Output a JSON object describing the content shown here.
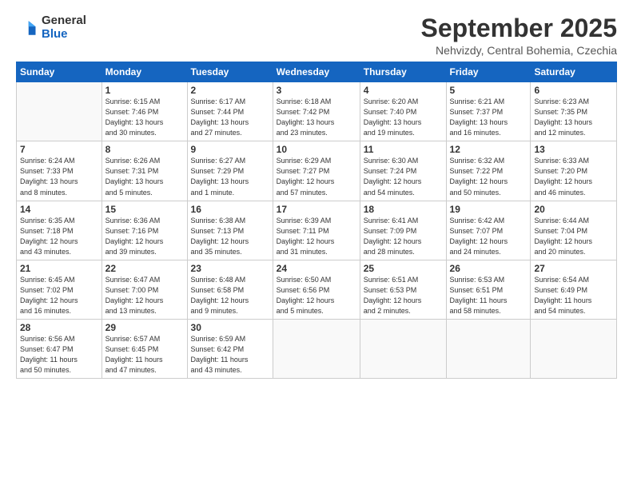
{
  "logo": {
    "general": "General",
    "blue": "Blue"
  },
  "title": "September 2025",
  "subtitle": "Nehvizdy, Central Bohemia, Czechia",
  "days_header": [
    "Sunday",
    "Monday",
    "Tuesday",
    "Wednesday",
    "Thursday",
    "Friday",
    "Saturday"
  ],
  "weeks": [
    [
      {
        "num": "",
        "info": ""
      },
      {
        "num": "1",
        "info": "Sunrise: 6:15 AM\nSunset: 7:46 PM\nDaylight: 13 hours\nand 30 minutes."
      },
      {
        "num": "2",
        "info": "Sunrise: 6:17 AM\nSunset: 7:44 PM\nDaylight: 13 hours\nand 27 minutes."
      },
      {
        "num": "3",
        "info": "Sunrise: 6:18 AM\nSunset: 7:42 PM\nDaylight: 13 hours\nand 23 minutes."
      },
      {
        "num": "4",
        "info": "Sunrise: 6:20 AM\nSunset: 7:40 PM\nDaylight: 13 hours\nand 19 minutes."
      },
      {
        "num": "5",
        "info": "Sunrise: 6:21 AM\nSunset: 7:37 PM\nDaylight: 13 hours\nand 16 minutes."
      },
      {
        "num": "6",
        "info": "Sunrise: 6:23 AM\nSunset: 7:35 PM\nDaylight: 13 hours\nand 12 minutes."
      }
    ],
    [
      {
        "num": "7",
        "info": "Sunrise: 6:24 AM\nSunset: 7:33 PM\nDaylight: 13 hours\nand 8 minutes."
      },
      {
        "num": "8",
        "info": "Sunrise: 6:26 AM\nSunset: 7:31 PM\nDaylight: 13 hours\nand 5 minutes."
      },
      {
        "num": "9",
        "info": "Sunrise: 6:27 AM\nSunset: 7:29 PM\nDaylight: 13 hours\nand 1 minute."
      },
      {
        "num": "10",
        "info": "Sunrise: 6:29 AM\nSunset: 7:27 PM\nDaylight: 12 hours\nand 57 minutes."
      },
      {
        "num": "11",
        "info": "Sunrise: 6:30 AM\nSunset: 7:24 PM\nDaylight: 12 hours\nand 54 minutes."
      },
      {
        "num": "12",
        "info": "Sunrise: 6:32 AM\nSunset: 7:22 PM\nDaylight: 12 hours\nand 50 minutes."
      },
      {
        "num": "13",
        "info": "Sunrise: 6:33 AM\nSunset: 7:20 PM\nDaylight: 12 hours\nand 46 minutes."
      }
    ],
    [
      {
        "num": "14",
        "info": "Sunrise: 6:35 AM\nSunset: 7:18 PM\nDaylight: 12 hours\nand 43 minutes."
      },
      {
        "num": "15",
        "info": "Sunrise: 6:36 AM\nSunset: 7:16 PM\nDaylight: 12 hours\nand 39 minutes."
      },
      {
        "num": "16",
        "info": "Sunrise: 6:38 AM\nSunset: 7:13 PM\nDaylight: 12 hours\nand 35 minutes."
      },
      {
        "num": "17",
        "info": "Sunrise: 6:39 AM\nSunset: 7:11 PM\nDaylight: 12 hours\nand 31 minutes."
      },
      {
        "num": "18",
        "info": "Sunrise: 6:41 AM\nSunset: 7:09 PM\nDaylight: 12 hours\nand 28 minutes."
      },
      {
        "num": "19",
        "info": "Sunrise: 6:42 AM\nSunset: 7:07 PM\nDaylight: 12 hours\nand 24 minutes."
      },
      {
        "num": "20",
        "info": "Sunrise: 6:44 AM\nSunset: 7:04 PM\nDaylight: 12 hours\nand 20 minutes."
      }
    ],
    [
      {
        "num": "21",
        "info": "Sunrise: 6:45 AM\nSunset: 7:02 PM\nDaylight: 12 hours\nand 16 minutes."
      },
      {
        "num": "22",
        "info": "Sunrise: 6:47 AM\nSunset: 7:00 PM\nDaylight: 12 hours\nand 13 minutes."
      },
      {
        "num": "23",
        "info": "Sunrise: 6:48 AM\nSunset: 6:58 PM\nDaylight: 12 hours\nand 9 minutes."
      },
      {
        "num": "24",
        "info": "Sunrise: 6:50 AM\nSunset: 6:56 PM\nDaylight: 12 hours\nand 5 minutes."
      },
      {
        "num": "25",
        "info": "Sunrise: 6:51 AM\nSunset: 6:53 PM\nDaylight: 12 hours\nand 2 minutes."
      },
      {
        "num": "26",
        "info": "Sunrise: 6:53 AM\nSunset: 6:51 PM\nDaylight: 11 hours\nand 58 minutes."
      },
      {
        "num": "27",
        "info": "Sunrise: 6:54 AM\nSunset: 6:49 PM\nDaylight: 11 hours\nand 54 minutes."
      }
    ],
    [
      {
        "num": "28",
        "info": "Sunrise: 6:56 AM\nSunset: 6:47 PM\nDaylight: 11 hours\nand 50 minutes."
      },
      {
        "num": "29",
        "info": "Sunrise: 6:57 AM\nSunset: 6:45 PM\nDaylight: 11 hours\nand 47 minutes."
      },
      {
        "num": "30",
        "info": "Sunrise: 6:59 AM\nSunset: 6:42 PM\nDaylight: 11 hours\nand 43 minutes."
      },
      {
        "num": "",
        "info": ""
      },
      {
        "num": "",
        "info": ""
      },
      {
        "num": "",
        "info": ""
      },
      {
        "num": "",
        "info": ""
      }
    ]
  ]
}
